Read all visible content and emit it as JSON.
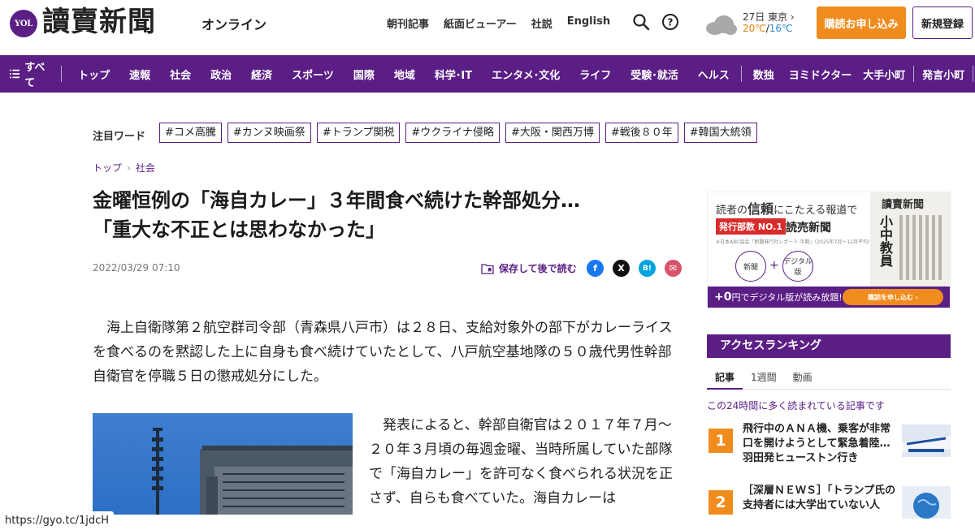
{
  "header": {
    "logo_badge": "YOL",
    "logo_text": "讀賣新聞",
    "logo_sub": "オンライン",
    "links": [
      "朝刊記事",
      "紙面ビューアー",
      "社説",
      "English"
    ],
    "weather": {
      "date_city": "27日 東京",
      "high": "20℃",
      "low": "16℃",
      "separator": "/"
    },
    "subscribe_label": "購読お申し込み",
    "register_label": "新規登録"
  },
  "nav": {
    "all_label": "すべて",
    "items_main": [
      "トップ",
      "速報",
      "社会",
      "政治",
      "経済",
      "スポーツ",
      "国際",
      "地域",
      "科学･IT",
      "エンタメ･文化",
      "ライフ",
      "受験･就活",
      "ヘルス"
    ],
    "items_extra": [
      "数独",
      "ヨミドクター",
      "大手小町",
      "発言小町"
    ]
  },
  "keywords": {
    "label": "注目ワード",
    "items": [
      "#コメ高騰",
      "#カンヌ映画祭",
      "#トランプ関税",
      "#ウクライナ侵略",
      "#大阪・関西万博",
      "#戦後８０年",
      "#韓国大統領"
    ]
  },
  "breadcrumb": [
    "トップ",
    "社会"
  ],
  "article": {
    "title_line1": "金曜恒例の「海自カレー」３年間食べ続けた幹部処分…",
    "title_line2": "「重大な不正とは思わなかった」",
    "date": "2022/03/29 07:10",
    "save_label": "保存して後で読む",
    "lead": "海上自衛隊第２航空群司令部（青森県八戸市）は２８日、支給対象外の部下がカレーライスを食べるのを黙認した上に自身も食べ続けていたとして、八戸航空基地隊の５０歳代男性幹部自衛官を停職５日の懲戒処分にした。",
    "body": "発表によると、幹部自衛官は２０１７年７月～２０年３月頃の毎週金曜、当時所属していた部隊で「海自カレー」を許可なく食べられる状況を正さず、自らも食べていた。海自カレーは"
  },
  "share": {
    "facebook": "f",
    "x": "X",
    "hatena": "B!",
    "mail": "✉"
  },
  "ad": {
    "lead_prefix": "読者の",
    "lead_highlight": "信頼",
    "lead_suffix": "にこたえる報道で",
    "badge": "発行部数 NO.1",
    "name": "読売新聞",
    "note": "※日本ABC協会「新聞発行社レポート 半期」（2025年7月～12月平均）",
    "circle_paper": "新聞",
    "circle_digital": "デジタル版",
    "paper_title": "讀賣新聞",
    "paper_headline": "小中教員",
    "bar_text_prefix": "+0",
    "bar_text_suffix": "円でデジタル版が読み放題!",
    "cta": "購読を申し込む"
  },
  "ranking": {
    "heading": "アクセスランキング",
    "tabs": [
      "記事",
      "1週間",
      "動画"
    ],
    "description": "この24時間に多く読まれている記事です",
    "items": [
      {
        "rank": "1",
        "text": "飛行中のＡＮＡ機、乗客が非常口を開けようとして緊急着陸…羽田発ヒューストン行き"
      },
      {
        "rank": "2",
        "text": "［深層ＮＥＷＳ］「トランプ氏の支持者には大学出ていない人"
      }
    ]
  },
  "status_url": "https://gyo.tc/1jdcH",
  "colors": {
    "brand_purple": "#5b1e85",
    "accent_orange": "#f08c1e"
  }
}
